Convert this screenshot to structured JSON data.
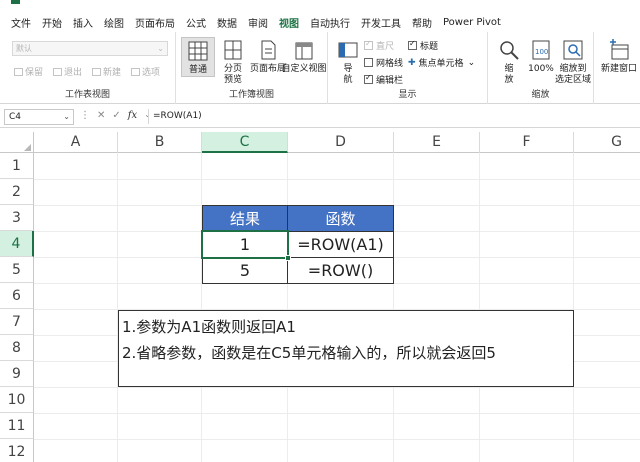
{
  "ribbon_tabs": [
    "文件",
    "开始",
    "插入",
    "绘图",
    "页面布局",
    "公式",
    "数据",
    "审阅",
    "视图",
    "自动执行",
    "开发工具",
    "帮助",
    "Power Pivot"
  ],
  "active_tab": "视图",
  "sheet_view_group": {
    "dropdown_value": "默认",
    "buttons": [
      "保留",
      "退出",
      "新建",
      "选项"
    ],
    "label": "工作表视图"
  },
  "workbook_view_group": {
    "buttons": [
      "普通",
      "分页\n预览",
      "页面布局",
      "自定义视图"
    ],
    "normal": "普通",
    "page_break_1": "分页",
    "page_break_2": "预览",
    "page_layout": "页面布局",
    "custom": "自定义视图",
    "label": "工作簿视图"
  },
  "show_group": {
    "nav": "导\n航",
    "nav_1": "导",
    "nav_2": "航",
    "ruler": "直尺",
    "gridlines": "网格线",
    "formula_bar": "编辑栏",
    "headings": "标题",
    "focus_cell": "焦点单元格",
    "label": "显示"
  },
  "zoom_group": {
    "zoom": "缩\n放",
    "zoom_1": "缩",
    "zoom_2": "放",
    "zoom100": "100%",
    "zoom_sel_1": "缩放到",
    "zoom_sel_2": "选定区域",
    "label": "缩放"
  },
  "window_group": {
    "new_window": "新建窗口"
  },
  "formula_bar": {
    "name_box": "C4",
    "formula": "=ROW(A1)"
  },
  "columns": [
    "A",
    "B",
    "C",
    "D",
    "E",
    "F",
    "G"
  ],
  "rows": [
    "1",
    "2",
    "3",
    "4",
    "5",
    "6",
    "7",
    "8",
    "9",
    "10",
    "11",
    "12"
  ],
  "table": {
    "headers": [
      "结果",
      "函数"
    ],
    "rows": [
      [
        "1",
        "=ROW(A1)"
      ],
      [
        "5",
        "=ROW()"
      ]
    ]
  },
  "note": [
    "1.参数为A1函数则返回A1",
    "2.省略参数，函数是在C5单元格输入的，所以就会返回5"
  ],
  "colors": {
    "accent": "#1e7145",
    "table_header": "#4472c4"
  }
}
